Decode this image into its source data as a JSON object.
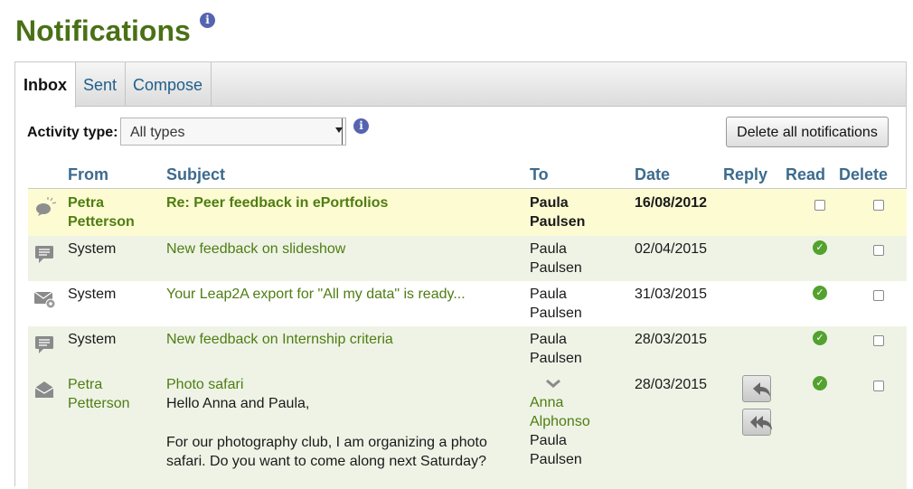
{
  "page": {
    "title": "Notifications"
  },
  "tabs": [
    {
      "label": "Inbox",
      "active": true
    },
    {
      "label": "Sent",
      "active": false
    },
    {
      "label": "Compose",
      "active": false
    }
  ],
  "filter": {
    "label": "Activity type:",
    "selected": "All types"
  },
  "actions": {
    "delete_all_label": "Delete all notifications"
  },
  "columns": {
    "from": "From",
    "subject": "Subject",
    "to": "To",
    "date": "Date",
    "reply": "Reply",
    "read": "Read",
    "delete": "Delete"
  },
  "rows": [
    {
      "icon": "activity-icon",
      "from": [
        "Petra",
        "Petterson"
      ],
      "subject": "Re: Peer feedback in ePortfolios",
      "to": [
        "Paula",
        "Paulsen"
      ],
      "date": "16/08/2012",
      "read": false
    },
    {
      "icon": "comment-icon",
      "from": [
        "System"
      ],
      "subject": "New feedback on slideshow",
      "to": [
        "Paula",
        "Paulsen"
      ],
      "date": "02/04/2015",
      "read": true
    },
    {
      "icon": "export-settings-icon",
      "from": [
        "System"
      ],
      "subject": "Your Leap2A export for \"All my data\" is ready...",
      "to": [
        "Paula",
        "Paulsen"
      ],
      "date": "31/03/2015",
      "read": true
    },
    {
      "icon": "comment-icon",
      "from": [
        "System"
      ],
      "subject": "New feedback on Internship criteria",
      "to": [
        "Paula",
        "Paulsen"
      ],
      "date": "28/03/2015",
      "read": true
    },
    {
      "icon": "envelope-icon",
      "from": [
        "Petra",
        "Petterson"
      ],
      "subject": "Photo safari",
      "body": [
        "Hello Anna and Paula,",
        "For our photography club, I am organizing a photo",
        "safari. Do you want to come along next Saturday?"
      ],
      "to": [
        "Anna",
        "Alphonso",
        "Paula",
        "Paulsen"
      ],
      "date": "28/03/2015",
      "read": true
    }
  ],
  "colors": {
    "accent": "#4a7016",
    "link": "#3d6b8e",
    "unread_bg": "#fdfbd2",
    "alt_bg": "#eef3e6",
    "read_icon": "#53a22f"
  }
}
